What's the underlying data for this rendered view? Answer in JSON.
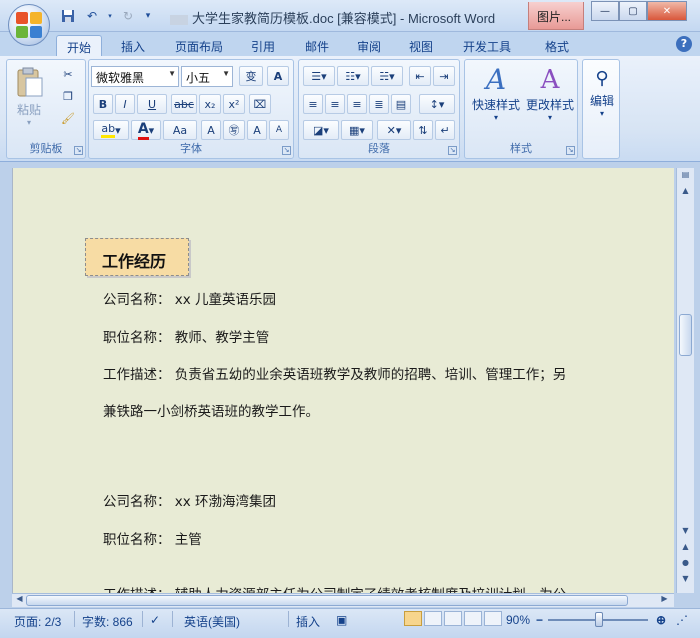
{
  "window": {
    "title": "大学生家教简历模板.doc [兼容模式] - Microsoft Word",
    "context_tab": "图片...",
    "minimize": "—",
    "maximize": "▢",
    "close": "✕"
  },
  "tabs": [
    "开始",
    "插入",
    "页面布局",
    "引用",
    "邮件",
    "审阅",
    "视图",
    "开发工具",
    "格式"
  ],
  "ribbon": {
    "clipboard": {
      "label": "剪贴板",
      "paste": "粘贴"
    },
    "font": {
      "label": "字体",
      "font_name": "微软雅黑",
      "font_size": "小五",
      "wen": "变",
      "a_box": "A",
      "bold": "B",
      "italic": "I",
      "underline": "U",
      "strike": "abc",
      "subscript": "x₂",
      "superscript": "x²",
      "change_case": "Aa",
      "font_color": "A",
      "grow": "A",
      "shrink": "A"
    },
    "paragraph": {
      "label": "段落"
    },
    "styles": {
      "label": "样式",
      "quick_styles": "快速样式",
      "change_styles": "更改样式"
    },
    "editing": {
      "label": "编辑"
    }
  },
  "document": {
    "section_title": "工作经历",
    "lines": [
      "公司名称：  xx 儿童英语乐园",
      "职位名称：  教师、教学主管",
      "工作描述：  负责省五幼的业余英语班教学及教师的招聘、培训、管理工作；另",
      "兼铁路一小剑桥英语班的教学工作。",
      "公司名称：  xx 环渤海湾集团",
      "职位名称：  主管",
      "工作描述：  辅助人力资源部主任为公司制定了绩效考核制度及培训计划，为公"
    ]
  },
  "status": {
    "page": "页面: 2/3",
    "words": "字数: 866",
    "language": "英语(美国)",
    "insert_mode": "插入",
    "zoom": "90%"
  },
  "colors": {
    "accent": "#15428b",
    "ribbon": "#dae6f5",
    "page": "#e8ebd5",
    "section_head": "#f7dca4"
  }
}
